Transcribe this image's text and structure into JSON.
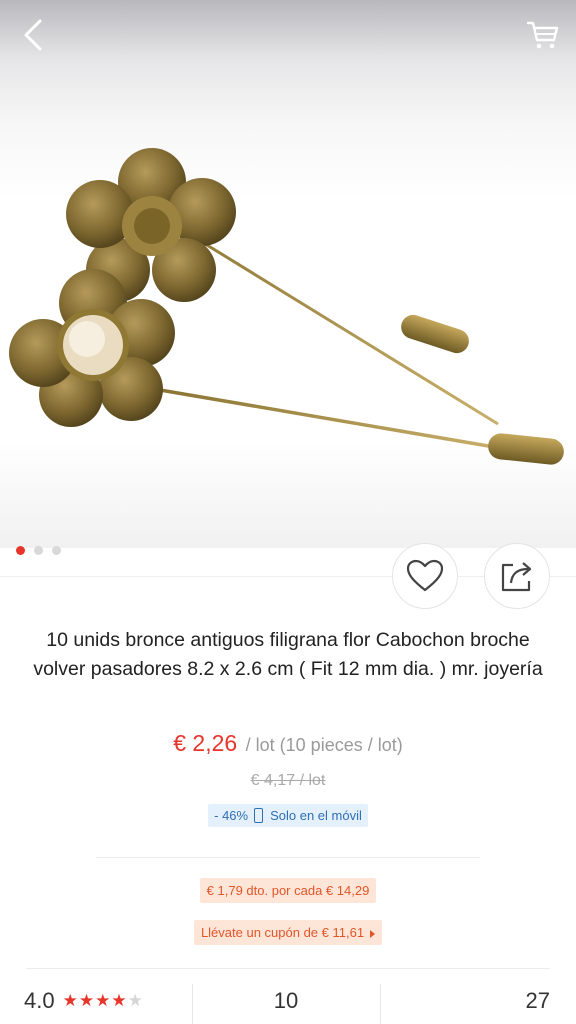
{
  "nav": {
    "back_icon": "back-chevron-icon",
    "cart_icon": "shopping-cart-icon"
  },
  "gallery": {
    "image_count": 3,
    "active_index": 0
  },
  "actions": {
    "favorite_icon": "heart-icon",
    "share_icon": "share-icon"
  },
  "product": {
    "title": "10 unids bronce antiguos filigrana flor Cabochon broche volver pasadores 8.2 x 2.6 cm ( Fit 12 mm dia. ) mr. joyería",
    "price": "€ 2,26",
    "unit": "/ lot (10 pieces / lot)",
    "old_price": "€ 4,17  / lot",
    "discount": "- 46%",
    "mobile_only": "Solo en el móvil"
  },
  "promos": {
    "volume_discount": "€ 1,79 dto. por cada € 14,29",
    "coupon": "Llévate un cupón de € 11,61"
  },
  "stats": {
    "rating": "4.0",
    "rating_value": 4,
    "rating_max": 5,
    "orders": "10",
    "wishlist": "27"
  },
  "colors": {
    "accent_red": "#e8352b",
    "promo_orange": "#e2552a",
    "promo_bg": "#fde6d8",
    "badge_blue": "#2e6fb6",
    "badge_bg": "#e4f0fb"
  }
}
